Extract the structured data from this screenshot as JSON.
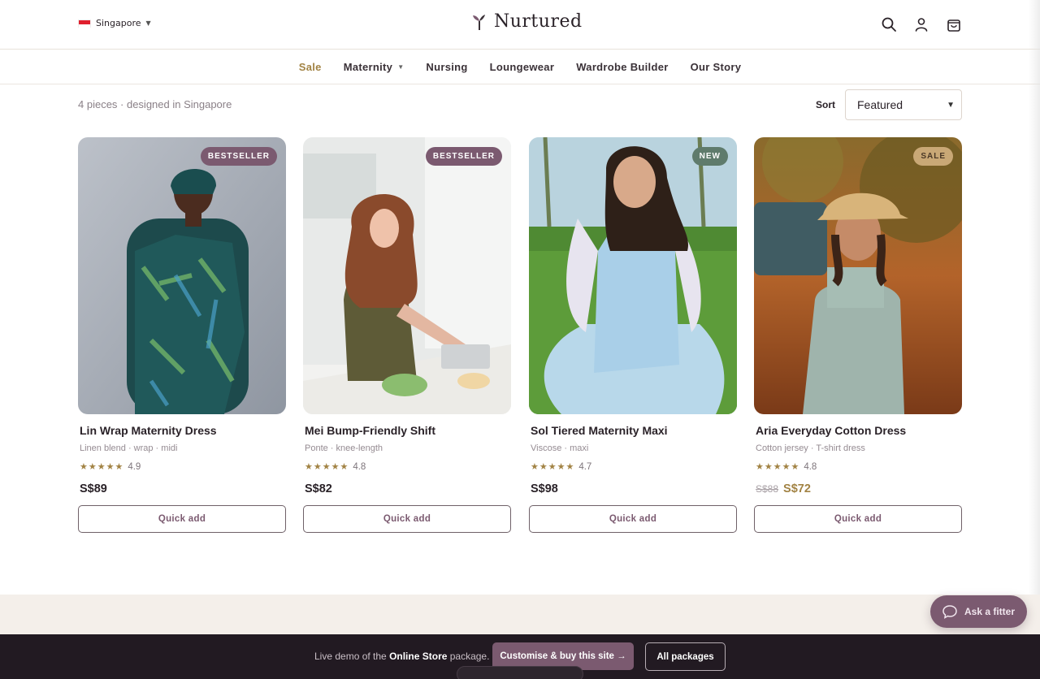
{
  "header": {
    "region": "Singapore",
    "brand": "Nurtured",
    "icons": [
      "search-icon",
      "account-icon",
      "cart-icon"
    ]
  },
  "nav": {
    "items": [
      {
        "label": "Sale",
        "accent": true
      },
      {
        "label": "Maternity",
        "dropdown": true
      },
      {
        "label": "Nursing"
      },
      {
        "label": "Loungewear"
      },
      {
        "label": "Wardrobe Builder"
      },
      {
        "label": "Our Story"
      }
    ]
  },
  "listing": {
    "meta": "4 pieces · designed in Singapore",
    "sort_label": "Sort",
    "sort_value": "Featured"
  },
  "products": [
    {
      "badge": "BESTSELLER",
      "name": "Lin Wrap Maternity Dress",
      "desc": "Linen blend · wrap · midi",
      "stars": "★★★★★",
      "rating": "4.9",
      "price": "S$89",
      "old_price": "",
      "quick_add": "Quick add"
    },
    {
      "badge": "BESTSELLER",
      "name": "Mei Bump-Friendly Shift",
      "desc": "Ponte · knee-length",
      "stars": "★★★★★",
      "rating": "4.8",
      "price": "S$82",
      "old_price": "",
      "quick_add": "Quick add"
    },
    {
      "badge": "NEW",
      "name": "Sol Tiered Maternity Maxi",
      "desc": "Viscose · maxi",
      "stars": "★★★★★",
      "rating": "4.7",
      "price": "S$98",
      "old_price": "",
      "quick_add": "Quick add"
    },
    {
      "badge": "SALE",
      "name": "Aria Everyday Cotton Dress",
      "desc": "Cotton jersey · T-shirt dress",
      "stars": "★★★★★",
      "rating": "4.8",
      "price": "S$72",
      "old_price": "S$88",
      "quick_add": "Quick add"
    }
  ],
  "fitter": {
    "label": "Ask a fitter"
  },
  "footer": {
    "text_prefix": "Live demo of the ",
    "text_bold": "Online Store",
    "text_suffix": " package.",
    "buy_label": "Customise & buy this site →",
    "all_label": "All packages"
  },
  "colors": {
    "accent_plum": "#7b5a70",
    "accent_gold": "#a28344",
    "footer_bg": "#221a22"
  }
}
